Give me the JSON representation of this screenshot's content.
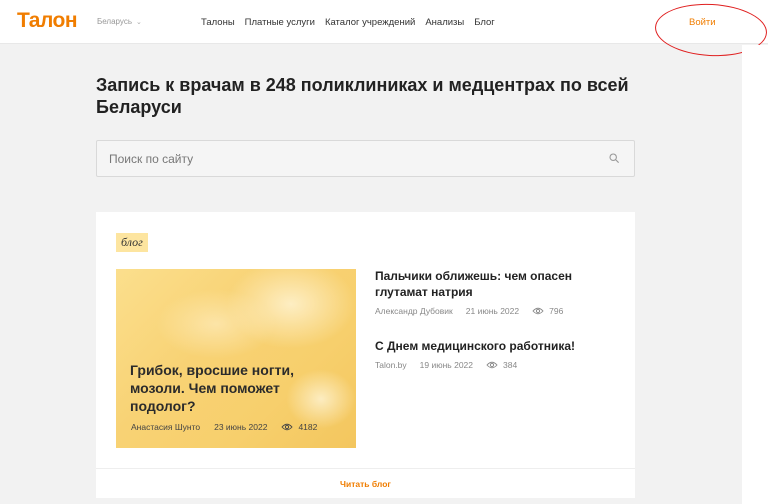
{
  "header": {
    "logo": "Талон",
    "region": "Беларусь",
    "nav": [
      "Талоны",
      "Платные услуги",
      "Каталог учреждений",
      "Анализы",
      "Блог"
    ],
    "login": "Войти"
  },
  "hero": {
    "title": "Запись к врачам в 248 поликлиниках и медцентрах по всей Беларуси"
  },
  "search": {
    "placeholder": "Поиск по сайту"
  },
  "blog": {
    "tag": "блог",
    "featured": {
      "title": "Грибок, вросшие ногти, мозоли. Чем поможет подолог?",
      "author": "Анастасия Шунто",
      "date": "23 июнь 2022",
      "views": "4182"
    },
    "posts": [
      {
        "title": "Пальчики оближешь: чем опасен глутамат натрия",
        "author": "Александр Дубовик",
        "date": "21 июнь 2022",
        "views": "796"
      },
      {
        "title": "С Днем медицинского работника!",
        "author": "Talon.by",
        "date": "19 июнь 2022",
        "views": "384"
      }
    ],
    "read_more": "Читать блог"
  },
  "colors": {
    "accent": "#f07d00",
    "tag_bg": "#fde5a0",
    "annotation": "#e02020"
  }
}
